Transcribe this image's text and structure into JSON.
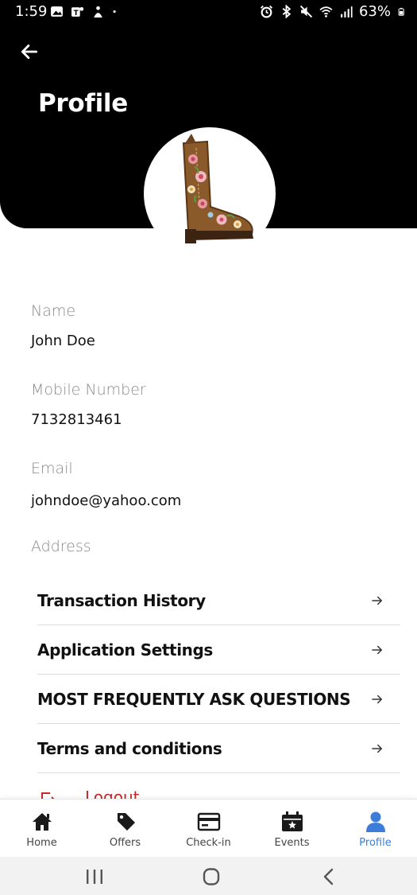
{
  "status_bar": {
    "time": "1:59",
    "battery_percent": "63%",
    "left_icons": [
      "gallery-icon",
      "teams-icon",
      "app-icon",
      "dot-icon"
    ],
    "right_icons": [
      "alarm-icon",
      "bluetooth-icon",
      "mute-icon",
      "wifi-icon",
      "signal-icon",
      "battery-icon"
    ]
  },
  "header": {
    "title": "Profile",
    "back_icon": "arrow-left-icon",
    "avatar_icon": "cowboy-boot-image"
  },
  "fields": {
    "name_label": "Name",
    "name_value": "John Doe",
    "mobile_label": "Mobile Number",
    "mobile_value": "7132813461",
    "email_label": "Email",
    "email_value": "johndoe@yahoo.com",
    "address_label": "Address"
  },
  "menu": {
    "items": [
      {
        "label": "Transaction History"
      },
      {
        "label": "Application Settings"
      },
      {
        "label": "MOST FREQUENTLY ASK QUESTIONS"
      },
      {
        "label": "Terms and conditions"
      }
    ],
    "logout_label": "Logout"
  },
  "bottom_nav": {
    "items": [
      {
        "label": "Home",
        "icon": "home-icon"
      },
      {
        "label": "Offers",
        "icon": "tag-icon"
      },
      {
        "label": "Check-in",
        "icon": "card-icon"
      },
      {
        "label": "Events",
        "icon": "calendar-star-icon"
      },
      {
        "label": "Profile",
        "icon": "user-icon"
      }
    ],
    "active": "Profile"
  },
  "colors": {
    "header_bg": "#000000",
    "active_nav": "#3b7dd8",
    "logout": "#c62828"
  }
}
